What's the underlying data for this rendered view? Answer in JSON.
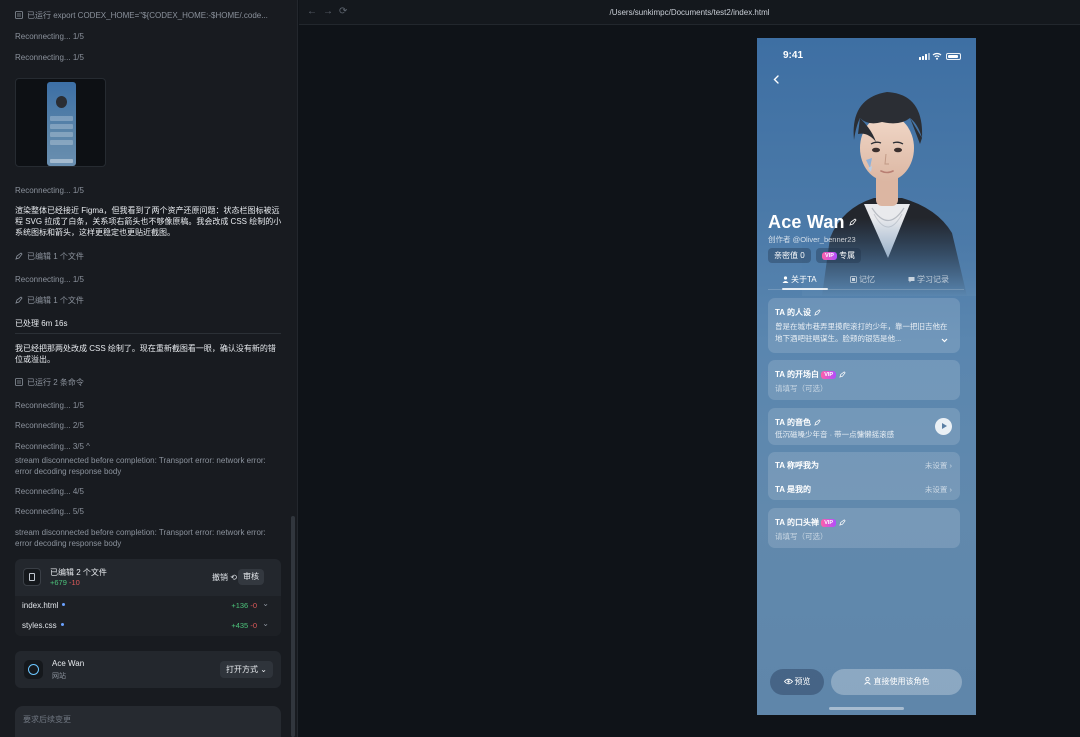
{
  "left_panel": {
    "lines": [
      {
        "text": "已运行 export CODEX_HOME=\"${CODEX_HOME:-$HOME/.code...",
        "icon": "terminal-icon"
      },
      {
        "text": "Reconnecting... 1/5"
      },
      {
        "text": "Reconnecting... 1/5"
      },
      {
        "text": "Reconnecting... 1/5"
      },
      {
        "text": "渲染整体已经接近 Figma，但我看到了两个资产还原问题：状态栏图标被远程 SVG 拉成了白条，关系项右箭头也不够像原稿。我会改成 CSS 绘制的小系统图标和箭头，这样更稳定也更贴近截图。"
      },
      {
        "text": "已编辑 1 个文件",
        "icon": "pencil-icon"
      },
      {
        "text": "Reconnecting... 1/5"
      },
      {
        "text": "已编辑 1 个文件",
        "icon": "pencil-icon"
      },
      {
        "text": "已处理 6m 16s"
      },
      {
        "text": "我已经把那两处改成 CSS 绘制了。现在重新截图看一眼，确认没有新的错位或溢出。"
      },
      {
        "text": "已运行 2 条命令",
        "icon": "terminal-icon"
      },
      {
        "text": "Reconnecting... 1/5"
      },
      {
        "text": "Reconnecting... 2/5"
      },
      {
        "text": "Reconnecting... 3/5 ^"
      },
      {
        "text": "stream disconnected before completion: Transport error: network error: error decoding response body"
      },
      {
        "text": "Reconnecting... 4/5"
      },
      {
        "text": "Reconnecting... 5/5"
      },
      {
        "text": "stream disconnected before completion: Transport error: network error: error decoding response body"
      }
    ],
    "file_card": {
      "title": "已编辑 2 个文件",
      "added": "+679",
      "removed": "-10",
      "undo_label": "撤销 ⟲",
      "review_label": "审核",
      "files": [
        {
          "name": "index.html",
          "added": "+136",
          "removed": "-0"
        },
        {
          "name": "styles.css",
          "added": "+435",
          "removed": "-0"
        }
      ]
    },
    "app_card": {
      "name": "Ace Wan",
      "type": "网站",
      "open_label": "打开方式 ⌄"
    },
    "composer": {
      "placeholder": "要求后续变更"
    }
  },
  "browser": {
    "url": "/Users/sunkimpc/Documents/test2/index.html",
    "nav": {
      "back": "←",
      "forward": "→",
      "reload": "⟳"
    }
  },
  "phone": {
    "time": "9:41",
    "name": "Ace Wan",
    "author": "创作者 @Oliver_benner23",
    "chips": {
      "intimacy": "亲密值 0",
      "vip": "VIP",
      "exclusive": "专属"
    },
    "tabs": [
      {
        "label": "关于TA",
        "icon": "person-icon"
      },
      {
        "label": "记忆",
        "icon": "memory-icon"
      },
      {
        "label": "学习记录",
        "icon": "chat-icon"
      }
    ],
    "cards": {
      "persona": {
        "title": "TA 的人设",
        "body": "曾是在城市巷弄里摸爬滚打的少年，靠一把旧吉他在地下酒吧驻唱谋生。脸颊的银箔是他..."
      },
      "opening": {
        "title": "TA 的开场白",
        "vip": "VIP",
        "body": "请填写（可选）"
      },
      "voice": {
        "title": "TA 的音色",
        "body": "低沉磁嗓少年音 · 带一点慵懒摇滚感"
      },
      "call_me": {
        "title": "TA 称呼我为",
        "value": "未设置"
      },
      "relation": {
        "title": "TA 是我的",
        "value": "未设置"
      },
      "catchphrase": {
        "title": "TA 的口头禅",
        "vip": "VIP",
        "body": "请填写（可选）"
      }
    },
    "bottom": {
      "preview": "预览",
      "use": "直接使用该角色"
    }
  }
}
